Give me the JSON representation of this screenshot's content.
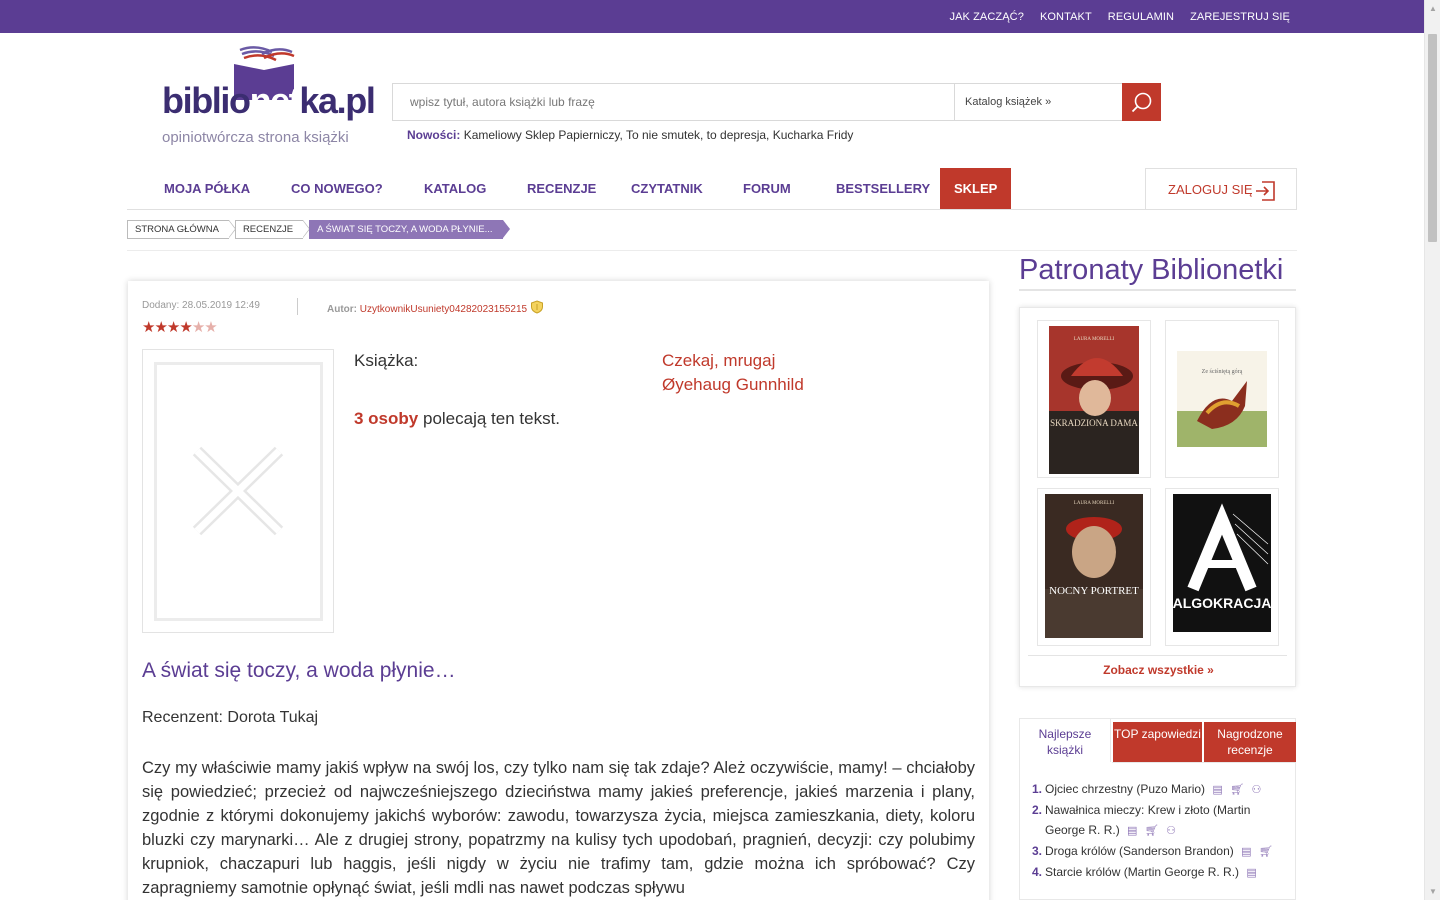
{
  "topbar": {
    "links": [
      "JAK ZACZĄĆ?",
      "KONTAKT",
      "REGULAMIN",
      "ZAREJESTRUJ SIĘ"
    ]
  },
  "logo": {
    "prefix": "biblio",
    "middle": "net",
    "suffix": "ka.pl",
    "tagline": "opiniotwórcza strona książki"
  },
  "search": {
    "placeholder": "wpisz tytuł, autora książki lub frazę",
    "catalog": "Katalog książek »"
  },
  "news": {
    "label": "Nowości:",
    "items": "Kameliowy Sklep Papierniczy, To nie smutek, to depresja, Kucharka Fridy"
  },
  "nav": {
    "items": [
      "MOJA PÓŁKA",
      "CO NOWEGO?",
      "KATALOG",
      "RECENZJE",
      "CZYTATNIK",
      "FORUM",
      "BESTSELLERY",
      "SKLEP"
    ],
    "login": "ZALOGUJ SIĘ"
  },
  "breadcrumb": [
    "STRONA GŁÓWNA",
    "RECENZJE",
    "A ŚWIAT SIĘ TOCZY, A WODA PŁYNIE..."
  ],
  "review": {
    "added": "Dodany: 28.05.2019 12:49",
    "author_label": "Autor:",
    "author_name": "UzytkownikUsuniety04282023155215",
    "rating": 4,
    "rating_max": 6,
    "book_label": "Książka:",
    "book_title": "Czekaj, mrugaj",
    "book_author": "Øyehaug Gunnhild",
    "recommend_count": "3 osoby",
    "recommend_text": "polecają ten tekst.",
    "title": "A świat się toczy, a woda płynie…",
    "reviewer": "Recenzent: Dorota Tukaj",
    "body": "Czy my właściwie mamy jakiś wpływ na swój los, czy tylko nam się tak zdaje? Ależ oczywiście, mamy! – chciałoby się powiedzieć; przecież od najwcześniejszego dzieciństwa mamy jakieś preferencje, jakieś marzenia i plany, zgodnie z którymi dokonujemy jakichś wyborów: zawodu, towarzysza życia, miejsca zamieszkania, diety, koloru bluzki czy marynarki… Ale z drugiej strony, popatrzmy na kulisy tych upodobań, pragnień, decyzji: czy polubimy krupniok, chaczapuri lub haggis, jeśli nigdy w życiu nie trafimy tam, gdzie można ich spróbować? Czy zapragniemy samotnie opłynąć świat, jeśli mdli nas nawet podczas spływu"
  },
  "sidebar": {
    "patronaty_title": "Patronaty Biblionetki",
    "covers": [
      {
        "author": "LAURA MORELLI",
        "title": "SKRADZIONA DAMA"
      },
      {
        "author": "",
        "title": "Ze ściśniętą górą"
      },
      {
        "author": "LAURA MORELLI",
        "title": "NOCNY PORTRET"
      },
      {
        "author": "",
        "title": "ALGOKRACJA"
      }
    ],
    "see_all": "Zobacz wszystkie »",
    "tabs": [
      "Najlepsze książki",
      "TOP zapowiedzi",
      "Nagrodzone recenzje"
    ],
    "ranking": [
      {
        "num": "1.",
        "text": "Ojciec chrzestny (Puzo Mario)"
      },
      {
        "num": "2.",
        "text": "Nawałnica mieczy: Krew i złoto (Martin George R. R.)"
      },
      {
        "num": "3.",
        "text": "Droga królów (Sanderson Brandon)"
      },
      {
        "num": "4.",
        "text": "Starcie królów (Martin George R. R.)"
      }
    ]
  },
  "colors": {
    "brand_purple": "#5b3d93",
    "accent_red": "#c0392b"
  }
}
